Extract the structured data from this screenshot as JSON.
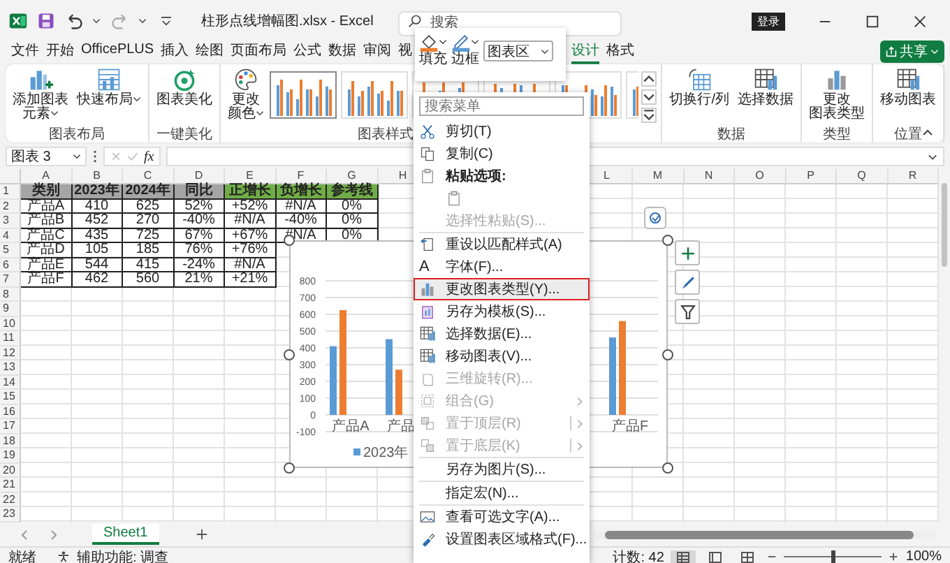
{
  "window": {
    "title": "柱形点线增幅图.xlsx - Excel",
    "search_placeholder": "搜索",
    "sign_in": "登录"
  },
  "menu_tabs": [
    {
      "label": "文件",
      "selected": false
    },
    {
      "label": "开始",
      "selected": false
    },
    {
      "label": "OfficePLUS",
      "selected": false
    },
    {
      "label": "插入",
      "selected": false
    },
    {
      "label": "绘图",
      "selected": false
    },
    {
      "label": "页面布局",
      "selected": false
    },
    {
      "label": "公式",
      "selected": false
    },
    {
      "label": "数据",
      "selected": false
    },
    {
      "label": "审阅",
      "selected": false
    },
    {
      "label": "视",
      "selected": false
    }
  ],
  "chart_tabs": [
    {
      "label": "设计",
      "selected": true
    },
    {
      "label": "格式",
      "selected": false
    }
  ],
  "share_button": "共享",
  "ribbon": {
    "groups": [
      {
        "label": "图表布局",
        "buttons": [
          {
            "lines": [
              "添加图表",
              "元素"
            ],
            "dropdown": true
          },
          {
            "lines": [
              "快速布局"
            ],
            "dropdown": true
          }
        ]
      },
      {
        "label": "一键美化",
        "buttons": [
          {
            "lines": [
              "图表美化"
            ],
            "dropdown": false
          }
        ]
      },
      {
        "label": "图表样式",
        "buttons": [
          {
            "lines": [
              "更改",
              "颜色"
            ],
            "dropdown": true
          }
        ],
        "styles": [
          {
            "selected": true
          },
          {
            "selected": false
          },
          {
            "selected": false
          },
          {
            "selected": false
          },
          {
            "selected": false
          },
          {
            "selected": false
          }
        ]
      },
      {
        "label": "数据",
        "buttons": [
          {
            "lines": [
              "切换行/列"
            ],
            "dropdown": false
          },
          {
            "lines": [
              "选择数据"
            ],
            "dropdown": false
          }
        ]
      },
      {
        "label": "类型",
        "buttons": [
          {
            "lines": [
              "更改",
              "图表类型"
            ],
            "dropdown": false
          }
        ]
      },
      {
        "label": "位置",
        "buttons": [
          {
            "lines": [
              "移动图表"
            ],
            "dropdown": false
          }
        ]
      }
    ]
  },
  "formula_bar": {
    "name_box": "图表 3",
    "function_label": "fx"
  },
  "sheet": {
    "columns_left": [
      "A",
      "B",
      "C",
      "D",
      "E",
      "F",
      "G",
      "H"
    ],
    "columns_right": [
      "L",
      "M",
      "N",
      "O",
      "P",
      "Q",
      "R"
    ],
    "row_numbers": [
      "1",
      "2",
      "3",
      "4",
      "5",
      "6",
      "7",
      "8",
      "9",
      "10",
      "11",
      "12",
      "13",
      "14",
      "15",
      "16",
      "17",
      "18",
      "19",
      "20",
      "21",
      "22",
      "23"
    ],
    "header": [
      {
        "text": "类别",
        "color": "#a5a5a5"
      },
      {
        "text": "2023年",
        "color": "#a5a5a5"
      },
      {
        "text": "2024年",
        "color": "#a5a5a5"
      },
      {
        "text": "同比",
        "color": "#a5a5a5"
      },
      {
        "text": "正增长",
        "color": "#70ad47"
      },
      {
        "text": "负增长",
        "color": "#70ad47"
      },
      {
        "text": "参考线",
        "color": "#70ad47"
      }
    ],
    "rows": [
      [
        "产品A",
        "410",
        "625",
        "52%",
        "+52%",
        "#N/A",
        "0%"
      ],
      [
        "产品B",
        "452",
        "270",
        "-40%",
        "#N/A",
        "-40%",
        "0%"
      ],
      [
        "产品C",
        "435",
        "725",
        "67%",
        "+67%",
        "#N/A",
        "0%"
      ],
      [
        "产品D",
        "105",
        "185",
        "76%",
        "+76%"
      ],
      [
        "产品E",
        "544",
        "415",
        "-24%",
        "#N/A"
      ],
      [
        "产品F",
        "462",
        "560",
        "21%",
        "+21%"
      ]
    ]
  },
  "chart": {
    "y_labels": [
      "800",
      "700",
      "600",
      "500",
      "400",
      "300",
      "200",
      "100",
      "0",
      "-100"
    ],
    "x_labels": [
      "产品A",
      "产品",
      "产品F"
    ],
    "legend": [
      {
        "label": "2023年",
        "color": "#5b9bd5"
      }
    ]
  },
  "mini_toolbar": {
    "fill_label": "填充",
    "border_label": "边框",
    "element_dropdown": "图表区"
  },
  "context_menu": {
    "search_placeholder": "搜索菜单",
    "items": [
      {
        "label": "剪切(T)",
        "kind": "plain",
        "disabled": false,
        "selected": false,
        "divider_before": false
      },
      {
        "label": "复制(C)",
        "kind": "plain",
        "disabled": false,
        "selected": false,
        "divider_before": false
      },
      {
        "label": "粘贴选项:",
        "kind": "heading",
        "disabled": false,
        "selected": false,
        "divider_before": false
      },
      {
        "kind": "paste-option",
        "disabled": false,
        "selected": false,
        "divider_before": false
      },
      {
        "label": "选择性粘贴(S)...",
        "kind": "plain",
        "disabled": true,
        "selected": false,
        "divider_before": false
      },
      {
        "label": "重设以匹配样式(A)",
        "kind": "plain",
        "disabled": false,
        "selected": false,
        "divider_before": true
      },
      {
        "label": "字体(F)...",
        "kind": "plain",
        "glyph": "A",
        "disabled": false,
        "selected": false,
        "divider_before": false
      },
      {
        "label": "更改图表类型(Y)...",
        "kind": "plain",
        "disabled": false,
        "selected": true,
        "divider_before": false
      },
      {
        "label": "另存为模板(S)...",
        "kind": "plain",
        "disabled": false,
        "selected": false,
        "divider_before": false
      },
      {
        "label": "选择数据(E)...",
        "kind": "plain",
        "disabled": false,
        "selected": false,
        "divider_before": false
      },
      {
        "label": "移动图表(V)...",
        "kind": "plain",
        "disabled": false,
        "selected": false,
        "divider_before": false
      },
      {
        "label": "三维旋转(R)...",
        "kind": "plain",
        "disabled": true,
        "selected": false,
        "divider_before": false
      },
      {
        "label": "组合(G)",
        "kind": "submenu",
        "disabled": true,
        "selected": false,
        "divider_before": false
      },
      {
        "label": "置于顶层(R)",
        "kind": "split",
        "disabled": true,
        "selected": false,
        "divider_before": false
      },
      {
        "label": "置于底层(K)",
        "kind": "split",
        "disabled": true,
        "selected": false,
        "divider_before": false
      },
      {
        "label": "另存为图片(S)...",
        "kind": "plain",
        "disabled": false,
        "selected": false,
        "divider_before": true
      },
      {
        "label": "指定宏(N)...",
        "kind": "plain",
        "disabled": false,
        "selected": false,
        "divider_before": true
      },
      {
        "label": "查看可选文字(A)...",
        "kind": "plain",
        "disabled": false,
        "selected": false,
        "divider_before": true
      },
      {
        "label": "设置图表区域格式(F)...",
        "kind": "plain",
        "disabled": false,
        "selected": false,
        "divider_before": false
      }
    ]
  },
  "sheet_tabs": [
    {
      "label": "Sheet1",
      "selected": true
    }
  ],
  "status_bar": {
    "ready": "就绪",
    "accessibility": "辅助功能: 调查",
    "count": "计数: 42",
    "views": [
      {
        "selected": true
      },
      {
        "selected": false
      },
      {
        "selected": false
      }
    ],
    "zoom": {
      "level": 0.5
    },
    "zoom_label": "100%"
  }
}
